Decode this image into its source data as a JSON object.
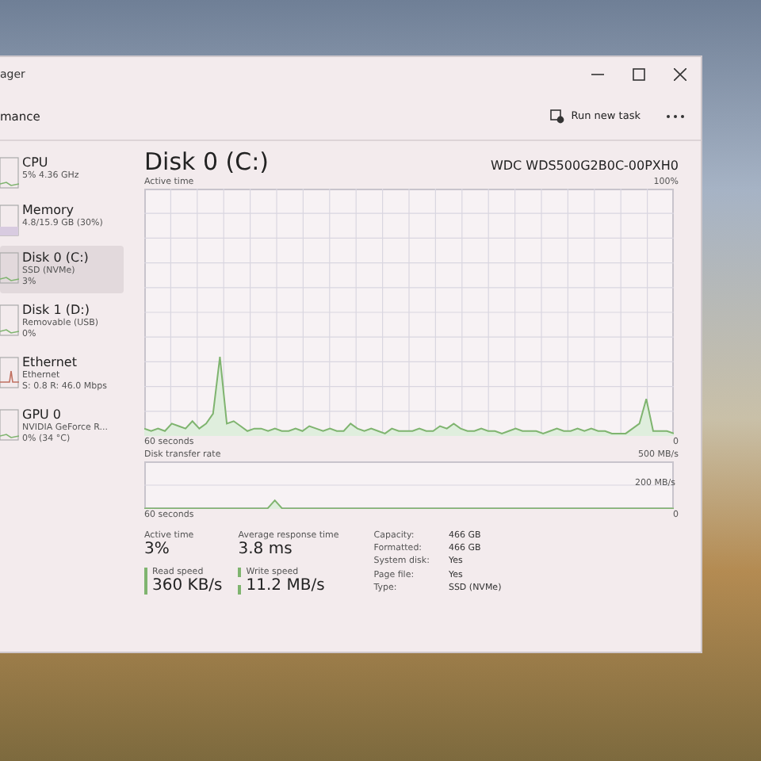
{
  "window": {
    "title": "ager"
  },
  "command_bar": {
    "section": "mance",
    "run_new_task": "Run new task"
  },
  "sidebar": {
    "items": [
      {
        "name": "CPU",
        "lines": [
          "5% 4.36 GHz"
        ],
        "selected": false,
        "kind": "line"
      },
      {
        "name": "Memory",
        "lines": [
          "4.8/15.9 GB (30%)"
        ],
        "selected": false,
        "kind": "fill"
      },
      {
        "name": "Disk 0 (C:)",
        "lines": [
          "SSD (NVMe)",
          "3%"
        ],
        "selected": true,
        "kind": "line"
      },
      {
        "name": "Disk 1 (D:)",
        "lines": [
          "Removable (USB)",
          "0%"
        ],
        "selected": false,
        "kind": "line"
      },
      {
        "name": "Ethernet",
        "lines": [
          "Ethernet",
          "S: 0.8 R: 46.0 Mbps"
        ],
        "selected": false,
        "kind": "spike"
      },
      {
        "name": "GPU 0",
        "lines": [
          "NVIDIA GeForce R...",
          "0% (34 °C)"
        ],
        "selected": false,
        "kind": "line"
      }
    ]
  },
  "main": {
    "title": "Disk 0 (C:)",
    "model": "WDC WDS500G2B0C-00PXH0",
    "active_chart": {
      "label": "Active time",
      "max": "100%",
      "span": "60 seconds",
      "min": "0"
    },
    "transfer_chart": {
      "label": "Disk transfer rate",
      "max": "500 MB/s",
      "mid": "200 MB/s",
      "span": "60 seconds",
      "min": "0"
    },
    "stats": [
      {
        "label": "Active time",
        "value": "3%",
        "kind": "plain"
      },
      {
        "label": "Average response time",
        "value": "3.8 ms",
        "kind": "plain"
      },
      {
        "label": "Read speed",
        "value": "360 KB/s",
        "kind": "solid"
      },
      {
        "label": "Write speed",
        "value": "11.2 MB/s",
        "kind": "dashed"
      }
    ],
    "properties": [
      {
        "label": "Capacity:",
        "value": "466 GB"
      },
      {
        "label": "Formatted:",
        "value": "466 GB"
      },
      {
        "label": "System disk:",
        "value": "Yes"
      },
      {
        "label": "Page file:",
        "value": "Yes"
      },
      {
        "label": "Type:",
        "value": "SSD (NVMe)"
      }
    ]
  }
}
